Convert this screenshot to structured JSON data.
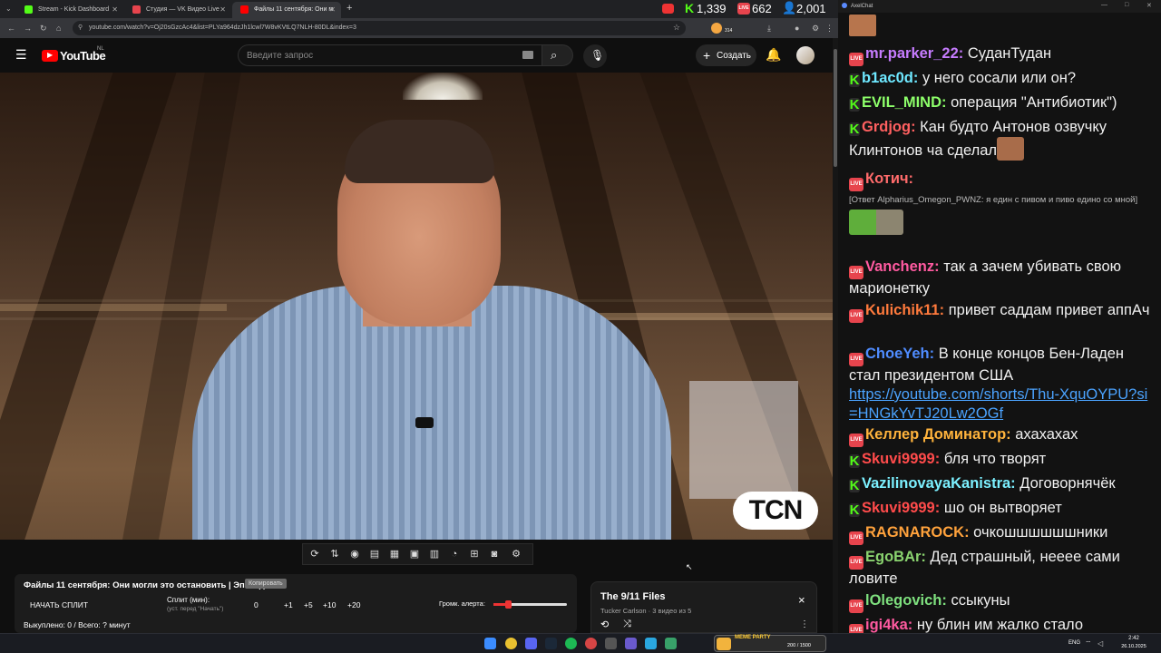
{
  "browser": {
    "tabs": [
      {
        "title": "Stream - Kick Dashboard",
        "color": "#53fc18"
      },
      {
        "title": "Студия — VK Видео Live",
        "color": "#e7444d"
      },
      {
        "title": "Файлы 11 сентября: Они м",
        "color": "#ff0000"
      }
    ],
    "new_tab": "+",
    "url": "youtube.com/watch?v=Oj20sGzcAc4&list=PLYa964dzJh1lcwl7W8vKVtLQ7NLH-80DL&index=3",
    "ext_badge": "314",
    "top_stats": {
      "kick_count": "1,339",
      "vk_count": "662",
      "viewers": "2,001"
    }
  },
  "youtube": {
    "logo": "YouTube",
    "region": "NL",
    "search_placeholder": "Введите запрос",
    "create_label": "Создать",
    "watermark": "TCN"
  },
  "split": {
    "title": "Файлы 11 сентября: Они могли это остановить | Эпизод 3",
    "tag": "Копировать",
    "start_label": "НАЧАТЬ СПЛИТ",
    "split_label": "Сплит (мин):",
    "split_hint": "(уст. перед \"Начать\")",
    "split_value": "0",
    "steps": [
      "+1",
      "+5",
      "+10",
      "+20"
    ],
    "alert_label": "Громк. алерта:",
    "alert_volume": 0.2,
    "status": "Выкуплено: 0 / Всего: ? минут"
  },
  "playlist": {
    "title": "The 9/11 Files",
    "meta": "Tucker Carlson · 3 видео из 5",
    "close": "×"
  },
  "chat": {
    "window_title": "AxelChat",
    "messages": [
      {
        "badge": "vk",
        "user": "mr.parker_22:",
        "color": "#c67cff",
        "text": "СуданТудан"
      },
      {
        "badge": "kick",
        "user": "b1ac0d:",
        "color": "#6ee8ff",
        "text": "у него сосали или он?"
      },
      {
        "badge": "kick",
        "user": "EVIL_MIND:",
        "color": "#8dff6a",
        "text": "операция \"Антибиотик\")"
      },
      {
        "badge": "kick",
        "user": "Grdjog:",
        "color": "#ff6060",
        "text": "Кан будто Антонов озвучку Клинтонов ча сделал"
      },
      {
        "badge": "vk",
        "user": "Котич:",
        "color": "#ff6b6b",
        "reply": "[Ответ Alpharius_Omegon_PWNZ: я един с пивом и пиво едино со мной]"
      },
      {
        "badge": "vk",
        "user": "Vanchenz:",
        "color": "#ff5aa0",
        "text": "так а зачем убивать свою марионетку"
      },
      {
        "badge": "vk",
        "user": "Kulichik11:",
        "color": "#ff7a3c",
        "text": "привет саддам привет аппАч"
      },
      {
        "badge": "vk",
        "user": "ChoeYeh:",
        "color": "#4f8cff",
        "text": "В конце концов Бен-Ладен стал президентом США",
        "link": "https://youtube.com/shorts/Thu-XquOYPU?si=HNGkYvTJ20Lw2OGf"
      },
      {
        "badge": "vk",
        "user": "Келлер Доминатор:",
        "color": "#ffb33c",
        "text": "ахахахах"
      },
      {
        "badge": "kick",
        "user": "Skuvi9999:",
        "color": "#ff4b4b",
        "text": "бля что творят"
      },
      {
        "badge": "kick",
        "user": "VazilinovayaKanistra:",
        "color": "#7cf0ff",
        "text": "Договорнячёк"
      },
      {
        "badge": "kick",
        "user": "Skuvi9999:",
        "color": "#ff4b4b",
        "text": "шо он вытворяет"
      },
      {
        "badge": "vk",
        "user": "RAGNAROCK:",
        "color": "#ffa23c",
        "text": "очкошшшшшшники"
      },
      {
        "badge": "vk",
        "user": "EgoBAr:",
        "color": "#8ad36f",
        "text": "Дед страшный, нееее сами ловите"
      },
      {
        "badge": "vk",
        "user": "lOlegovich:",
        "color": "#7ee07e",
        "text": "ссыкуны"
      },
      {
        "badge": "vk",
        "user": "igi4ka:",
        "color": "#ff5aa0",
        "text": "ну блин им жалко стало"
      }
    ]
  },
  "taskbar": {
    "widget": "MEME PARTY",
    "widget_progress": "200 / 1500",
    "lang": "ENG",
    "time": "2:42",
    "date": "26.10.2025"
  }
}
